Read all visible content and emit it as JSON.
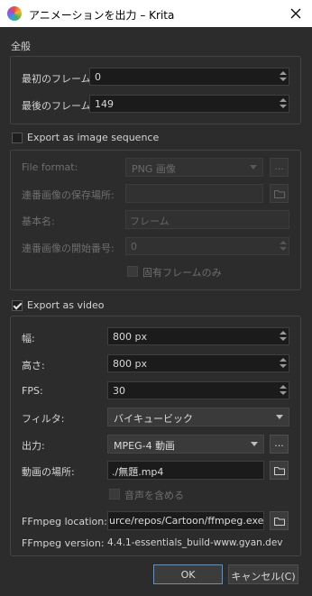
{
  "window": {
    "title": "アニメーションを出力 – Krita",
    "close_icon": "close-icon",
    "logo_icon": "krita-logo-icon"
  },
  "general": {
    "title": "全般",
    "first_frame_label": "最初のフレーム:",
    "first_frame_value": "0",
    "last_frame_label": "最後のフレーム:",
    "last_frame_value": "149"
  },
  "image_sequence": {
    "toggle_label": "Export as image sequence",
    "checked": false,
    "file_format_label": "File format:",
    "file_format_value": "PNG 画像",
    "options_button": "...",
    "save_location_label": "連番画像の保存場所:",
    "save_location_value": "",
    "base_name_label": "基本名:",
    "base_name_value": "フレーム",
    "start_number_label": "連番画像の開始番号:",
    "start_number_value": "0",
    "unique_frames_label": "固有フレームのみ"
  },
  "video": {
    "toggle_label": "Export as video",
    "checked": true,
    "width_label": "幅:",
    "width_value": "800 px",
    "height_label": "高さ:",
    "height_value": "800 px",
    "fps_label": "FPS:",
    "fps_value": "30",
    "filter_label": "フィルタ:",
    "filter_value": "バイキュービック",
    "output_label": "出力:",
    "output_value": "MPEG-4 動画",
    "options_button": "...",
    "location_label": "動画の場所:",
    "location_value": "./無題.mp4",
    "include_audio_label": "音声を含める",
    "ffmpeg_location_label": "FFmpeg location:",
    "ffmpeg_location_value": "urce/repos/Cartoon/ffmpeg.exe",
    "ffmpeg_version_label": "FFmpeg version:",
    "ffmpeg_version_value": "4.4.1-essentials_build-www.gyan.dev"
  },
  "buttons": {
    "ok": "OK",
    "cancel": "キャンセル(C)"
  },
  "colors": {
    "background": "#2c2c2c",
    "ok_border": "#6c8fb4"
  }
}
